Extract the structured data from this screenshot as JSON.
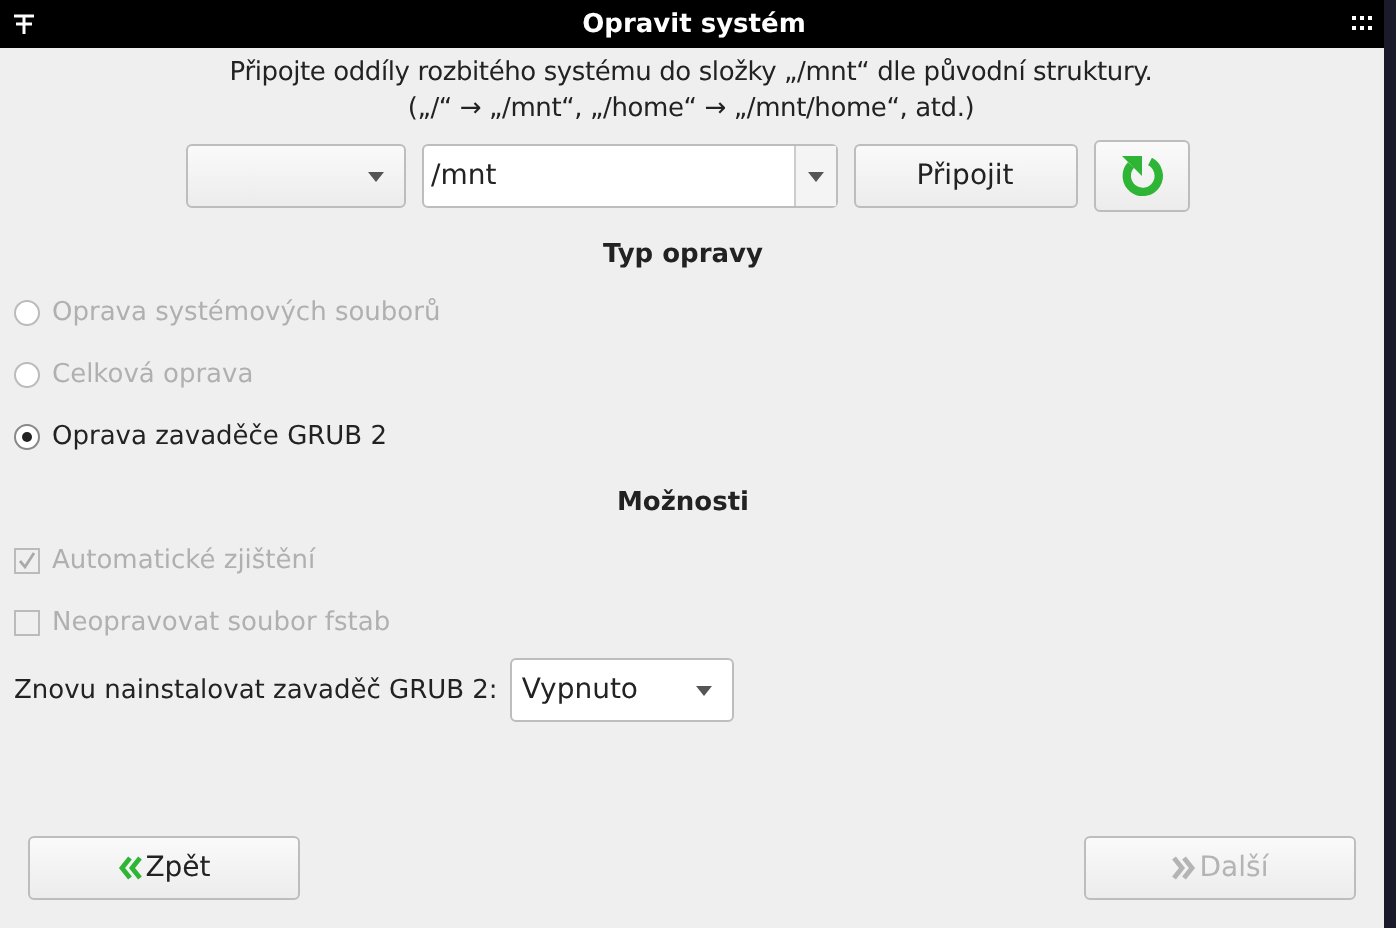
{
  "window": {
    "title": "Opravit systém"
  },
  "instructions": [
    "Připojte oddíly rozbitého systému do složky „/mnt“ dle původní struktury.",
    "(„/“ → „/mnt“, „/home“ → „/mnt/home“, atd.)"
  ],
  "mount_row": {
    "mount_point": {
      "value": "/mnt"
    },
    "mount_button": "Připojit"
  },
  "repair_type": {
    "heading": "Typ opravy",
    "options": [
      {
        "label": "Oprava systémových souborů",
        "selected": false,
        "disabled": true
      },
      {
        "label": "Celková oprava",
        "selected": false,
        "disabled": true
      },
      {
        "label": "Oprava zavaděče GRUB 2",
        "selected": true,
        "disabled": false
      }
    ]
  },
  "options": {
    "heading": "Možnosti",
    "checkboxes": [
      {
        "label": "Automatické zjištění",
        "checked": true,
        "disabled": true
      },
      {
        "label": "Neopravovat soubor fstab",
        "checked": false,
        "disabled": true
      }
    ],
    "reinstall": {
      "label": "Znovu nainstalovat zavaděč GRUB 2:",
      "value": "Vypnuto"
    }
  },
  "buttons": [
    {
      "label": "Zpět",
      "kind": "back",
      "disabled": false
    },
    {
      "label": "Další",
      "kind": "next",
      "disabled": true
    }
  ]
}
